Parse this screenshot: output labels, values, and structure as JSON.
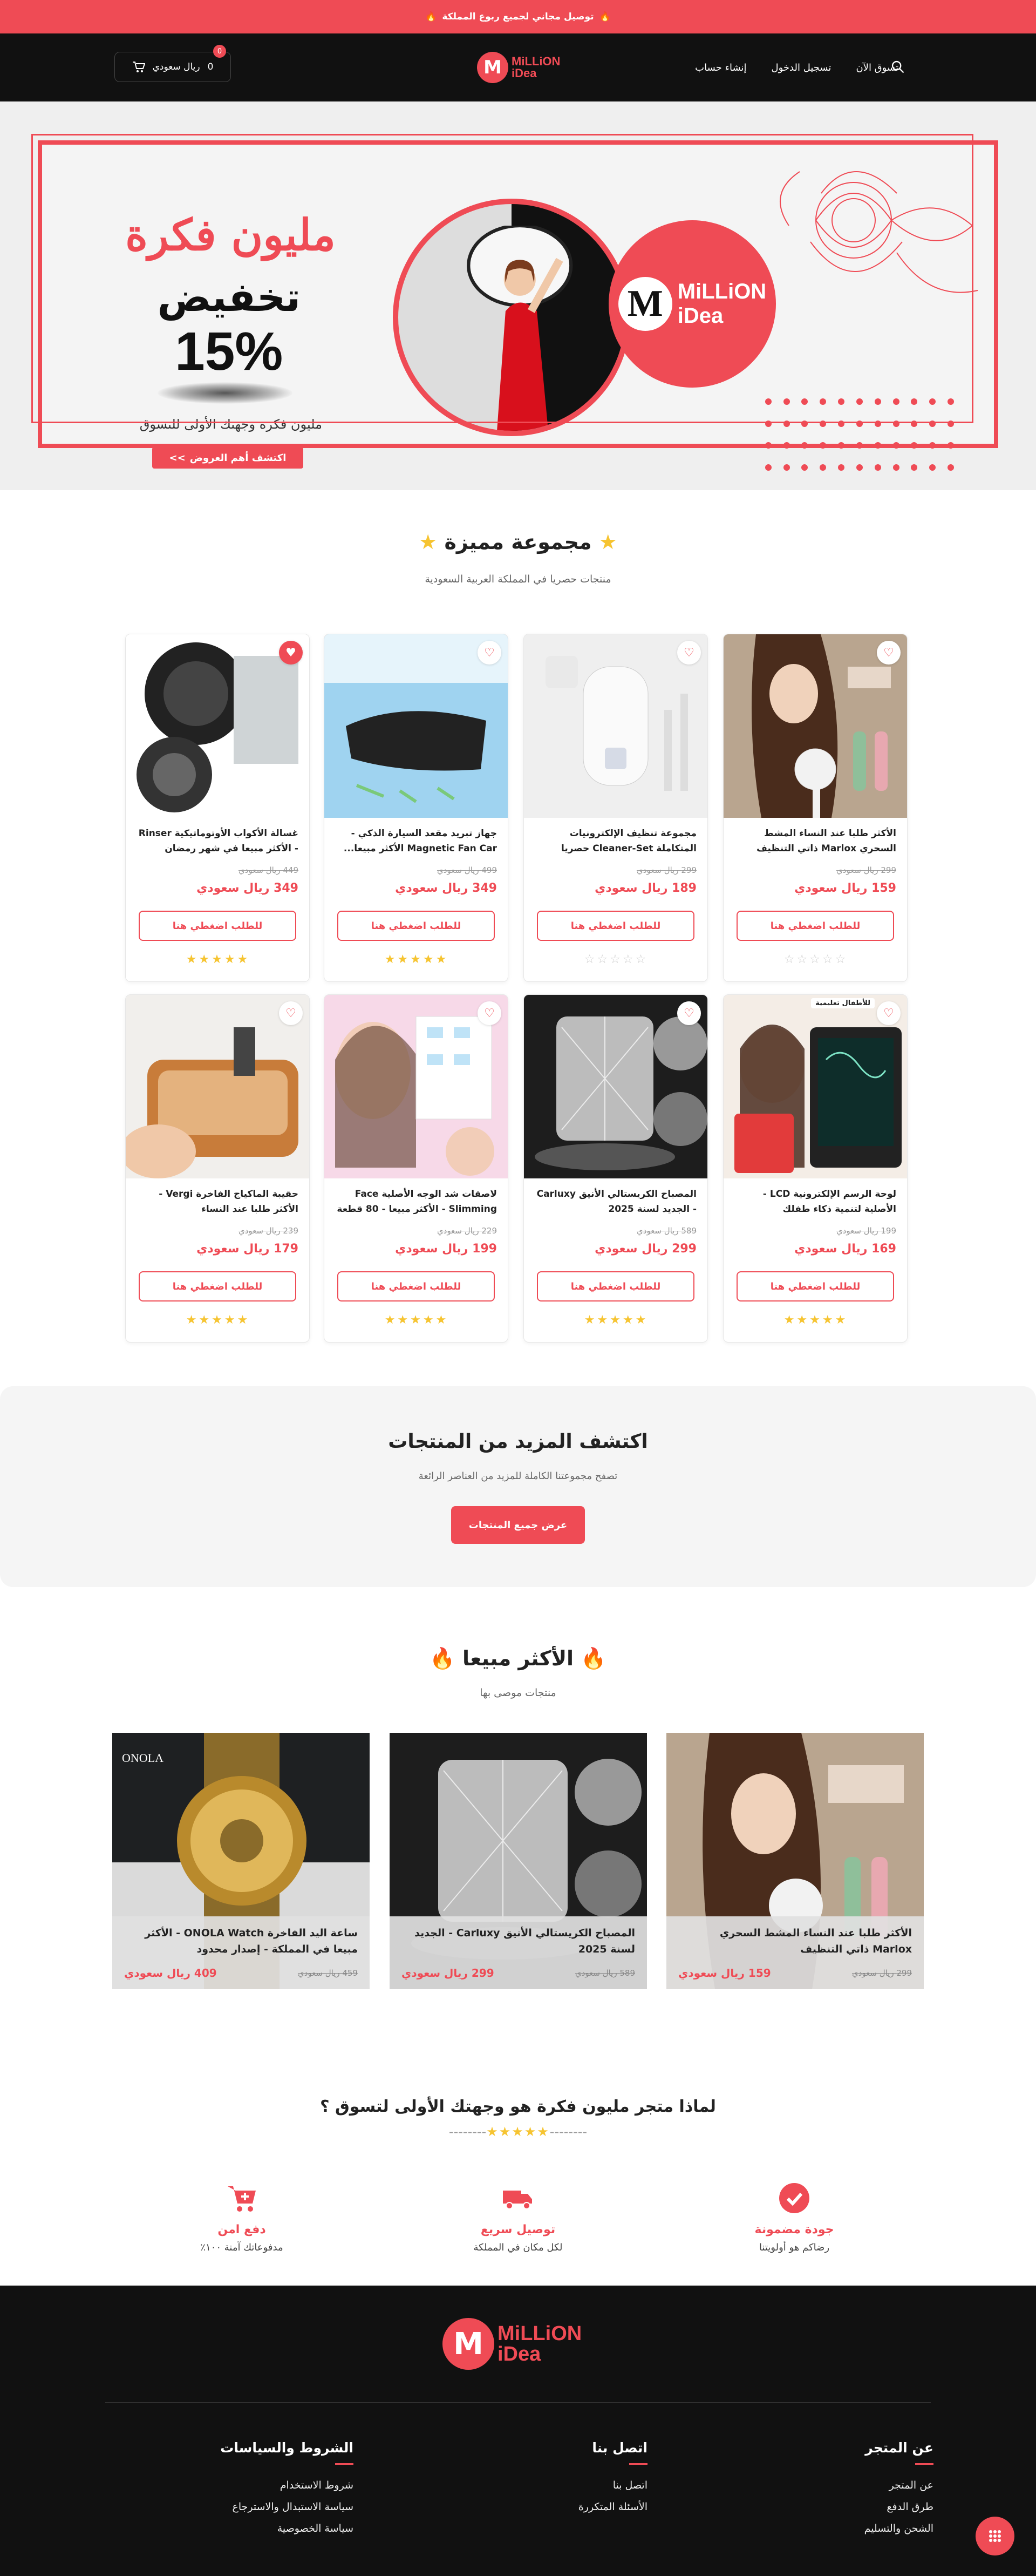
{
  "announcement": {
    "text": "توصيل مجاني لجميع ربوع المملكة",
    "icon_left": "🔥",
    "icon_right": "🔥"
  },
  "header": {
    "nav": [
      "تسوق الآن",
      "تسجيل الدخول",
      "إنشاء حساب"
    ],
    "logo": {
      "line1": "MiLLiON",
      "line2": "iDea"
    },
    "cart": {
      "amount": "0",
      "currency": "ريال سعودي",
      "badge": "0"
    }
  },
  "hero": {
    "title": "مليون فكرة",
    "discount_word": "تخفيض",
    "discount_value": "15%",
    "tagline": "مليون فكرة وجهتك الأولى للتسوق",
    "button": "اكتشف أهم العروض",
    "button_arrows": ">>",
    "badge_line1": "MiLLiON",
    "badge_line2": "iDea"
  },
  "featured": {
    "title": "مجموعة مميزة",
    "subtitle": "منتجات حصريا في المملكة العربية السعودية",
    "products": [
      {
        "name": "الأكثر طلبا عند النساء المشط السحري Marlox ذاتي التنظيف",
        "old_price": "299 ريال سعودي",
        "price": "159 ريال سعودي",
        "cta": "للطلب اضغطي هنا",
        "rating": 0,
        "heart_filled": false,
        "image": "hair-brush"
      },
      {
        "name": "مجموعة تنظيف الإلكترونيات المتكاملة Cleaner-Set حصريا في...",
        "old_price": "299 ريال سعودي",
        "price": "189 ريال سعودي",
        "cta": "للطلب اضغطي هنا",
        "rating": 0,
        "heart_filled": false,
        "image": "cleaner-set"
      },
      {
        "name": "جهاز تبريد مقعد السيارة الذكي - Magnetic Fan Car الأكثر مبيعا...",
        "old_price": "499 ريال سعودي",
        "price": "349 ريال سعودي",
        "cta": "للطلب اضغطي هنا",
        "rating": 4.5,
        "heart_filled": false,
        "image": "car-fan"
      },
      {
        "name": "غسالة الأكواب الأوتوماتيكية Rinser - الأكثر مبيعا في شهر رمضان",
        "old_price": "449 ريال سعودي",
        "price": "349 ريال سعودي",
        "cta": "للطلب اضغطي هنا",
        "rating": 4.5,
        "heart_filled": true,
        "image": "cup-rinser"
      },
      {
        "name": "لوحة الرسم الإلكترونية LCD - الأصلية لتنمية ذكاء طفلك",
        "old_price": "199 ريال سعودي",
        "price": "169 ريال سعودي",
        "cta": "للطلب اضغطي هنا",
        "rating": 5,
        "heart_filled": false,
        "image": "lcd-tablet",
        "tag": "للأطفال تعليمية"
      },
      {
        "name": "المصباح الكريستالي الأنيق Carluxy - الجديد لسنة 2025",
        "old_price": "589 ريال سعودي",
        "price": "299 ريال سعودي",
        "cta": "للطلب اضغطي هنا",
        "rating": 5,
        "heart_filled": false,
        "image": "crystal-lamp"
      },
      {
        "name": "لاصقات شد الوجه الأصلية Face Slimming - الأكثر مبيعا - 80 قطعة",
        "old_price": "229 ريال سعودي",
        "price": "199 ريال سعودي",
        "cta": "للطلب اضغطي هنا",
        "rating": 5,
        "heart_filled": false,
        "image": "face-patches"
      },
      {
        "name": "حقيبة الماكياج الفاخرة Vergi - الأكثر طلبا عند النساء",
        "old_price": "239 ريال سعودي",
        "price": "179 ريال سعودي",
        "cta": "للطلب اضغطي هنا",
        "rating": 5,
        "heart_filled": false,
        "image": "makeup-bag"
      }
    ]
  },
  "discover": {
    "title": "اكتشف المزيد من المنتجات",
    "subtitle": "تصفح مجموعتنا الكاملة للمزيد من العناصر الرائعة",
    "button": "عرض جميع المنتجات"
  },
  "best_sellers": {
    "title": "الأكثر مبيعا",
    "subtitle": "منتجات موصى بها",
    "items": [
      {
        "name": "الأكثر طلبا عند النساء المشط السحري Marlox ذاتي التنظيف",
        "old_price": "299 ريال سعودي",
        "price": "159 ريال سعودي",
        "image": "hair-brush"
      },
      {
        "name": "المصباح الكريستالي الأنيق Carluxy - الجديد لسنة 2025",
        "old_price": "589 ريال سعودي",
        "price": "299 ريال سعودي",
        "image": "crystal-lamp"
      },
      {
        "name": "ساعة اليد الفاخرة ONOLA Watch - الأكثر مبيعا في المملكة - إصدار محدود",
        "old_price": "459 ريال سعودي",
        "price": "409 ريال سعودي",
        "image": "gold-watch",
        "brand": "ONOLA"
      }
    ]
  },
  "why": {
    "title": "لماذا متجر مليون فكرة هو وجهتك الأولى لتسوق ؟",
    "features": [
      {
        "title": "جودة مضمونة",
        "desc": "رضاكم هو أولويتنا",
        "icon": "check-badge-icon"
      },
      {
        "title": "توصيل سريع",
        "desc": "لكل مكان في المملكة",
        "icon": "truck-icon"
      },
      {
        "title": "دفع امن",
        "desc": "مدفوعاتك آمنة ١٠٠٪",
        "icon": "cart-plus-icon"
      }
    ]
  },
  "footer": {
    "logo": {
      "line1": "MiLLiON",
      "line2": "iDea"
    },
    "columns": [
      {
        "title": "عن المتجر",
        "links": [
          "عن المتجر",
          "طرق الدفع",
          "الشحن والتسليم"
        ]
      },
      {
        "title": "اتصل بنا",
        "links": [
          "اتصل بنا",
          "الأسئلة المتكررة"
        ]
      },
      {
        "title": "الشروط والسياسات",
        "links": [
          "شروط الاستخدام",
          "سياسة الاستبدال والاسترجاع",
          "سياسة الخصوصية"
        ]
      }
    ]
  },
  "colors": {
    "brand": "#ef4b55",
    "dark": "#111111",
    "star": "#f6c431"
  }
}
